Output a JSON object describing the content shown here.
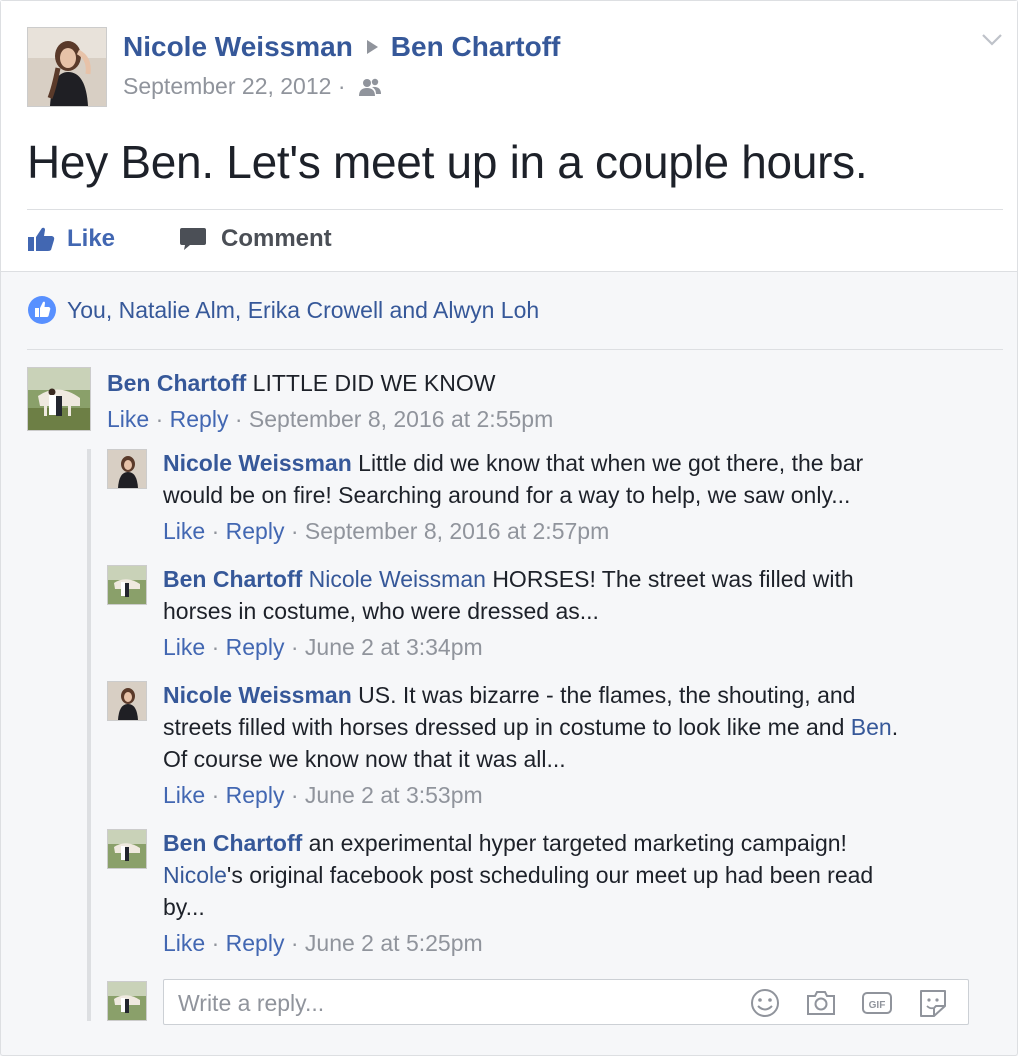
{
  "post": {
    "author": "Nicole Weissman",
    "recipient": "Ben Chartoff",
    "date": "September 22, 2012",
    "separator": "·",
    "audience_icon": "friends-icon",
    "text": "Hey Ben. Let's meet up in a couple hours."
  },
  "actions": {
    "like_label": "Like",
    "comment_label": "Comment"
  },
  "likes_summary": "You, Natalie Alm, Erika Crowell and Alwyn Loh",
  "comments": [
    {
      "author": "Ben Chartoff",
      "text": "LITTLE DID WE KNOW",
      "like": "Like",
      "reply": "Reply",
      "time": "September 8, 2016 at 2:55pm"
    }
  ],
  "replies": [
    {
      "author": "Nicole Weissman",
      "text_line1": "Little did we know that when we got there, the bar",
      "text_line2": "would be on fire! Searching around for a way to help, we saw only...",
      "like": "Like",
      "reply": "Reply",
      "time": "September 8, 2016 at 2:57pm"
    },
    {
      "author": "Ben Chartoff",
      "mention": "Nicole Weissman",
      "text_line1": "HORSES! The street was filled with",
      "text_line2": "horses in costume, who were dressed as...",
      "like": "Like",
      "reply": "Reply",
      "time": "June 2 at 3:34pm"
    },
    {
      "author": "Nicole Weissman",
      "text_line1": "US. It was bizarre - the flames, the shouting, and",
      "text_line2a": "streets filled with horses dressed up in costume to look like me and ",
      "mention": "Ben",
      "text_line2b": ".",
      "text_line3": "Of course we know now that it was all...",
      "like": "Like",
      "reply": "Reply",
      "time": "June 2 at 3:53pm"
    },
    {
      "author": "Ben Chartoff",
      "text_line1": "an experimental hyper targeted marketing campaign!",
      "mention": "Nicole",
      "text_line2": "'s original facebook post scheduling our meet up had been read",
      "text_line3": "by...",
      "like": "Like",
      "reply": "Reply",
      "time": "June 2 at 5:25pm"
    }
  ],
  "reply_box": {
    "placeholder": "Write a reply...",
    "icons": [
      "emoji-icon",
      "camera-icon",
      "gif-icon",
      "sticker-icon"
    ]
  },
  "colors": {
    "link": "#365899",
    "accent": "#4267b2",
    "meta": "#90949c"
  }
}
